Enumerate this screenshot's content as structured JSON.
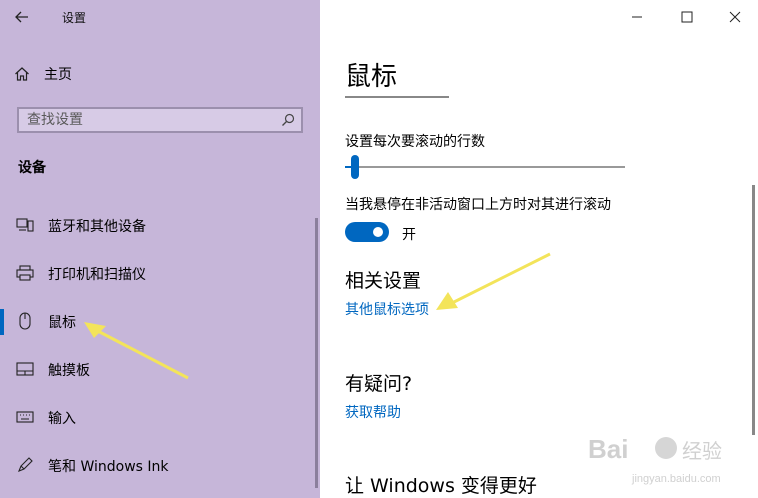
{
  "window": {
    "title": "设置"
  },
  "sidebar": {
    "home_label": "主页",
    "search_placeholder": "查找设置",
    "section_title": "设备",
    "items": [
      {
        "label": "蓝牙和其他设备",
        "icon": "bluetooth-devices-icon"
      },
      {
        "label": "打印机和扫描仪",
        "icon": "printer-icon"
      },
      {
        "label": "鼠标",
        "icon": "mouse-icon",
        "selected": true
      },
      {
        "label": "触摸板",
        "icon": "touchpad-icon"
      },
      {
        "label": "输入",
        "icon": "keyboard-icon"
      },
      {
        "label": "笔和 Windows Ink",
        "icon": "pen-icon"
      }
    ]
  },
  "main": {
    "page_title": "鼠标",
    "scroll_lines_label": "设置每次要滚动的行数",
    "scroll_lines_value": 3,
    "scroll_lines_max": 100,
    "inactive_scroll_label": "当我悬停在非活动窗口上方时对其进行滚动",
    "inactive_scroll_on": true,
    "toggle_state_label": "开",
    "related_heading": "相关设置",
    "related_link": "其他鼠标选项",
    "question_heading": "有疑问?",
    "help_link": "获取帮助",
    "improve_heading": "让 Windows 变得更好"
  },
  "colors": {
    "sidebar_bg": "#c6b6d9",
    "accent": "#0067c0",
    "annotation_arrow": "#f3e45a"
  },
  "watermark": {
    "brand": "Bai",
    "brand_cn": "经验",
    "url": "jingyan.baidu.com"
  }
}
